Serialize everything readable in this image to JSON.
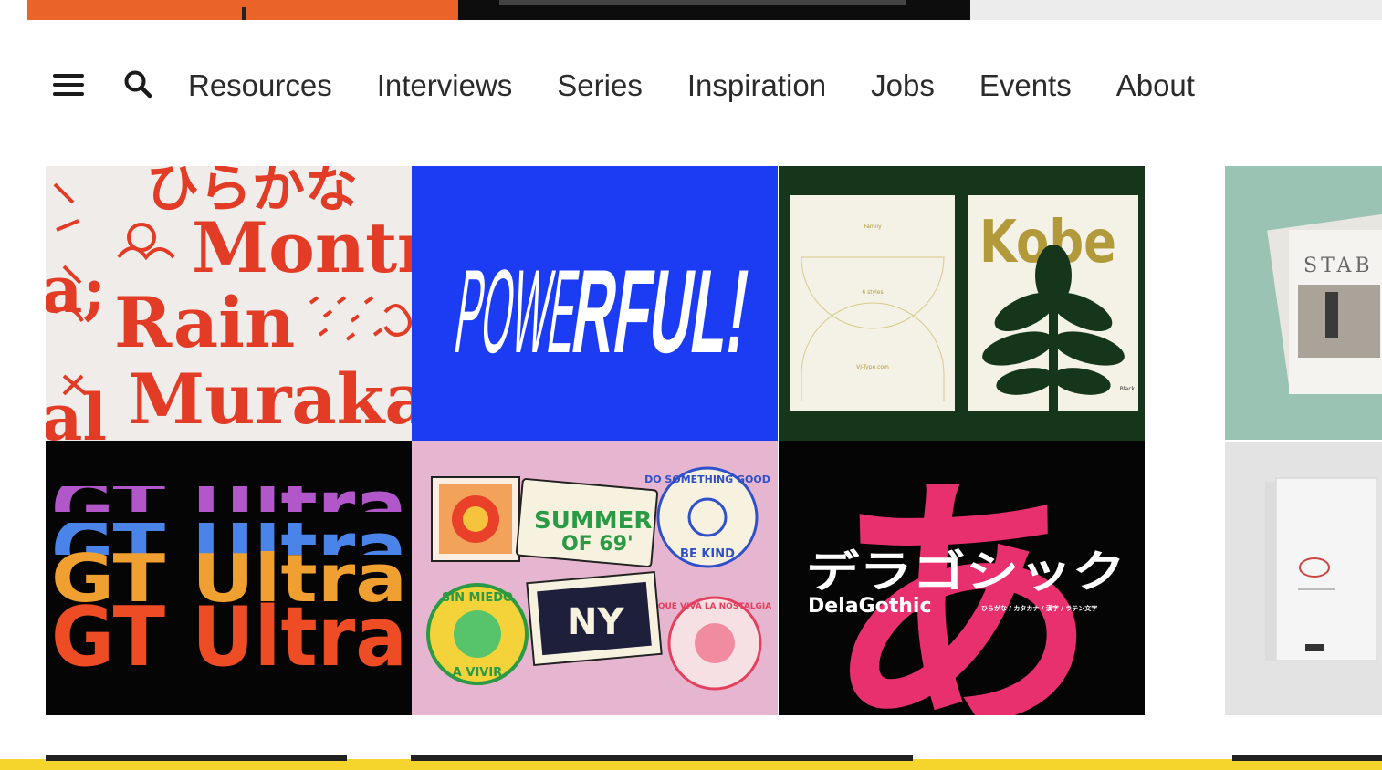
{
  "nav": {
    "menu_icon": "hamburger-menu-icon",
    "search_icon": "search-icon",
    "links": [
      "Resources",
      "Interviews",
      "Series",
      "Inspiration",
      "Jobs",
      "Events",
      "About"
    ]
  },
  "tiles": {
    "t1": {
      "lines": [
        "ひらかな",
        "Montr",
        "Rain",
        "Muraka"
      ]
    },
    "t2": {
      "text_light": "POWE",
      "text_bold": "RFUL!"
    },
    "t3": {
      "family": "Family",
      "styles": "6 styles",
      "site": "VJ-Type.com",
      "word": "Kobe",
      "weight": "Black"
    },
    "t4": {
      "rows": [
        "GT Ultra",
        "GT Ultra",
        "GT Ultra",
        "GT Ultra"
      ]
    },
    "t5": {
      "stickers": [
        "SUMMER",
        "OF 69'",
        "DO SOMETHING GOOD",
        "BE KIND",
        "SIN MIEDO",
        "A VIVIR",
        "NY",
        "QUE VIVA LA NOSTALGIA"
      ]
    },
    "t6": {
      "jp": "デラゴシック",
      "name": "DelaGothic",
      "big": "あ",
      "caption": "ひらがな / カタカナ / 漢字 / ラテン文字"
    }
  },
  "side": {
    "cover_title": "STAB"
  },
  "colors": {
    "accent_yellow": "#f5d42c",
    "power_blue": "#1b3cf2",
    "kobe_green": "#15361a",
    "dela_pink": "#e8306f"
  }
}
